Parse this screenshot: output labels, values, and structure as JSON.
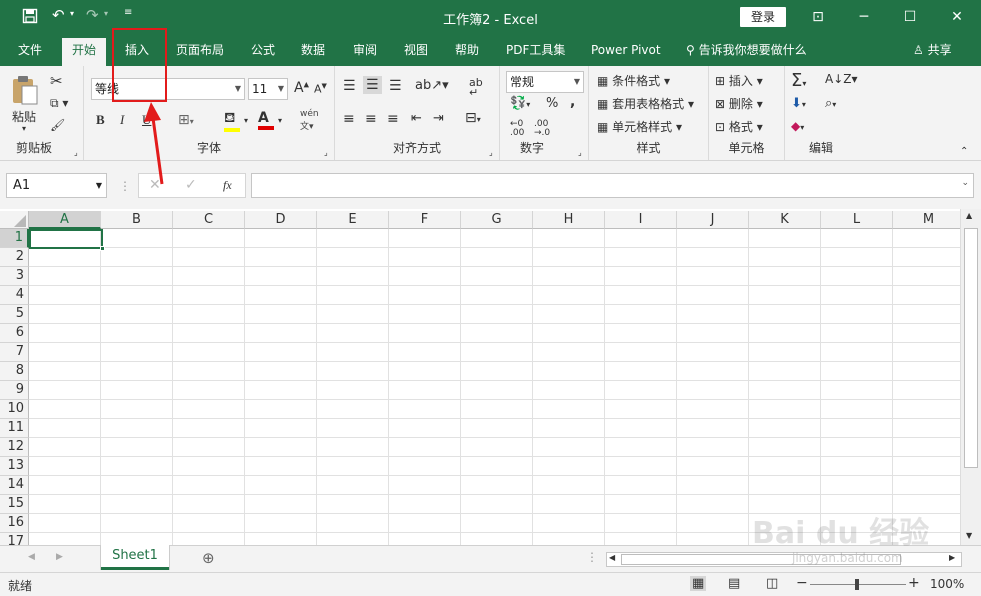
{
  "window": {
    "title": "工作簿2 - Excel",
    "login_label": "登录"
  },
  "tabs": [
    {
      "label": "文件"
    },
    {
      "label": "开始"
    },
    {
      "label": "插入"
    },
    {
      "label": "页面布局"
    },
    {
      "label": "公式"
    },
    {
      "label": "数据"
    },
    {
      "label": "审阅"
    },
    {
      "label": "视图"
    },
    {
      "label": "帮助"
    },
    {
      "label": "PDF工具集"
    },
    {
      "label": "Power Pivot"
    },
    {
      "label": "告诉我你想要做什么"
    }
  ],
  "share_label": "共享",
  "ribbon": {
    "clipboard": {
      "paste_label": "粘贴",
      "group_label": "剪贴板"
    },
    "font": {
      "family": "等线",
      "size": "11",
      "group_label": "字体",
      "bold": "B",
      "italic": "I",
      "underline": "U",
      "wen": "wén"
    },
    "align": {
      "group_label": "对齐方式"
    },
    "number": {
      "format": "常规",
      "percent": "%",
      "comma": ",",
      "group_label": "数字"
    },
    "styles": {
      "cond_format": "条件格式",
      "table_format": "套用表格格式",
      "cell_styles": "单元格样式",
      "group_label": "样式"
    },
    "cells": {
      "insert": "插入",
      "delete": "删除",
      "format": "格式",
      "group_label": "单元格"
    },
    "editing": {
      "group_label": "编辑"
    }
  },
  "formula_bar": {
    "name_box": "A1",
    "fx": "fx",
    "value": ""
  },
  "columns": [
    "A",
    "B",
    "C",
    "D",
    "E",
    "F",
    "G",
    "H",
    "I",
    "J",
    "K",
    "L",
    "M"
  ],
  "rows": [
    "1",
    "2",
    "3",
    "4",
    "5",
    "6",
    "7",
    "8",
    "9",
    "10",
    "11",
    "12",
    "13",
    "14",
    "15",
    "16",
    "17"
  ],
  "sheets": [
    {
      "label": "Sheet1"
    }
  ],
  "status": {
    "ready": "就绪",
    "zoom": "100%"
  },
  "watermark": {
    "text": "Bai du 经验",
    "url": "jingyan.baidu.com"
  },
  "colors": {
    "accent": "#217346",
    "annotation": "#e21b1b"
  }
}
